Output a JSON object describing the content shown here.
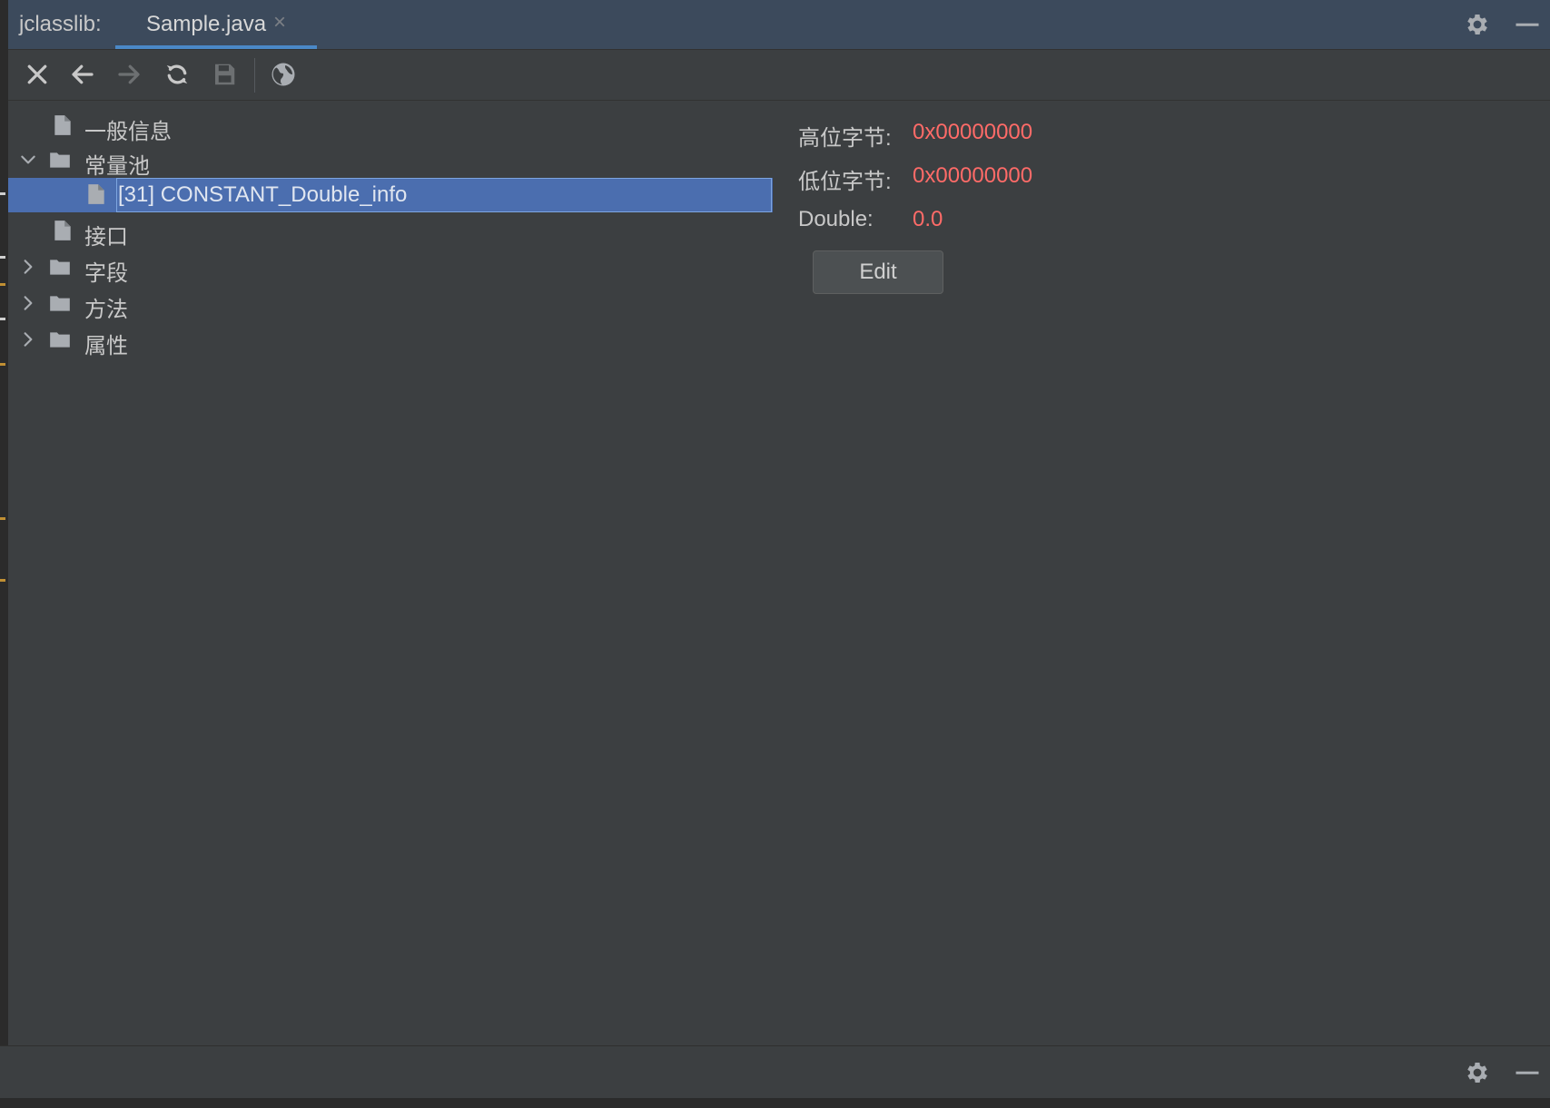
{
  "header": {
    "title": "jclasslib:",
    "tab": {
      "label": "Sample.java",
      "close": "×"
    },
    "icons": [
      "gear-icon",
      "minimize-icon"
    ]
  },
  "toolbar": {
    "icons": [
      "close-icon",
      "back-arrow-icon",
      "forward-arrow-icon",
      "refresh-icon",
      "save-icon",
      "web-icon"
    ]
  },
  "tree": {
    "items": [
      {
        "label": "一般信息",
        "type": "leaf",
        "expanded": null,
        "selected": false,
        "depth": 0
      },
      {
        "label": "常量池",
        "type": "folder",
        "expanded": true,
        "selected": false,
        "depth": 0
      },
      {
        "label": "[31] CONSTANT_Double_info",
        "type": "leaf",
        "expanded": null,
        "selected": true,
        "depth": 1
      },
      {
        "label": "接口",
        "type": "leaf",
        "expanded": null,
        "selected": false,
        "depth": 0
      },
      {
        "label": "字段",
        "type": "folder",
        "expanded": false,
        "selected": false,
        "depth": 0
      },
      {
        "label": "方法",
        "type": "folder",
        "expanded": false,
        "selected": false,
        "depth": 0
      },
      {
        "label": "属性",
        "type": "folder",
        "expanded": false,
        "selected": false,
        "depth": 0
      }
    ]
  },
  "details": {
    "rows": [
      {
        "label": "高位字节:",
        "value": "0x00000000"
      },
      {
        "label": "低位字节:",
        "value": "0x00000000"
      },
      {
        "label": "Double:",
        "value": "0.0"
      }
    ],
    "edit_label": "Edit"
  },
  "colors": {
    "background": "#3c3f41",
    "header": "#3c4a5c",
    "selection": "#4b6eaf",
    "accent": "#4a88c7",
    "value": "#ff6b68"
  }
}
